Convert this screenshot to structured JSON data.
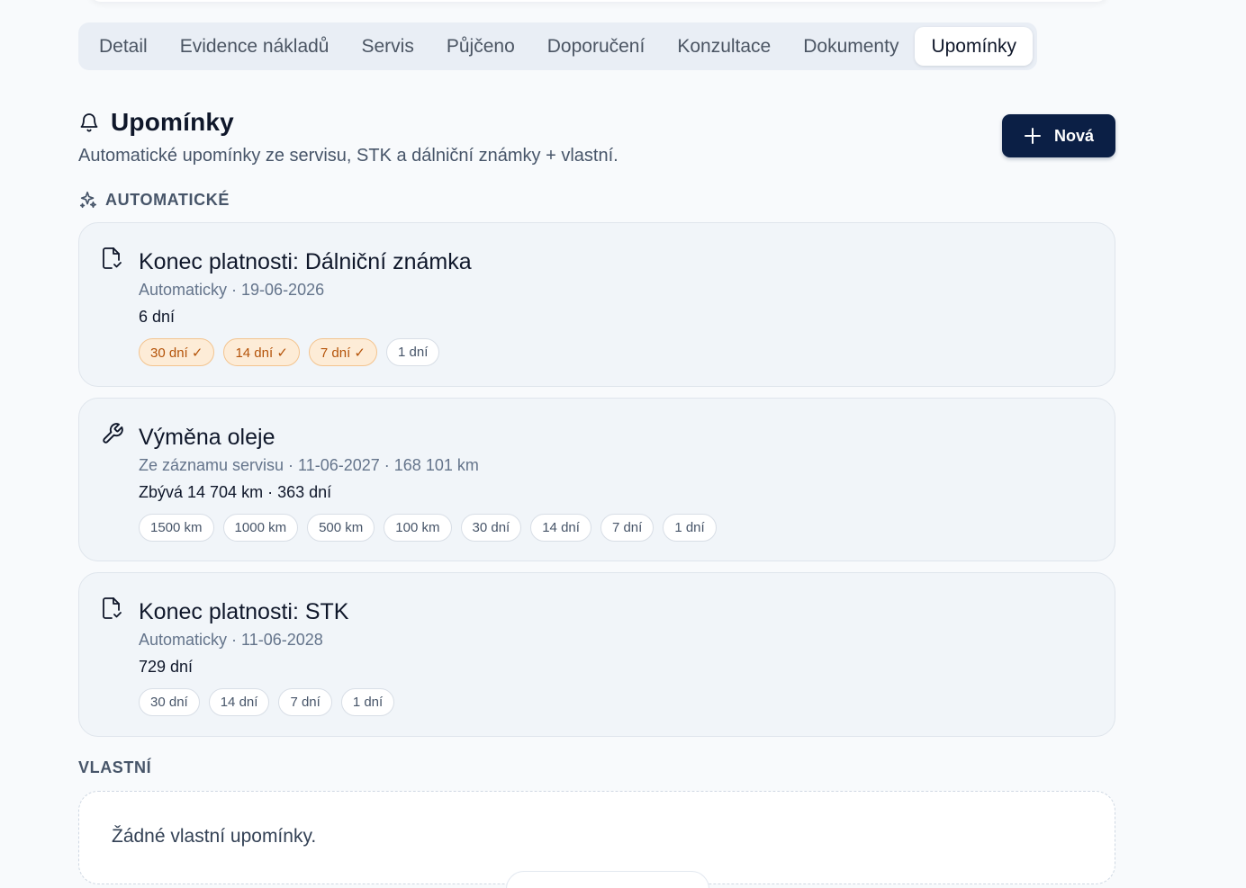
{
  "tabs": [
    {
      "label": "Detail"
    },
    {
      "label": "Evidence nákladů"
    },
    {
      "label": "Servis"
    },
    {
      "label": "Půjčeno"
    },
    {
      "label": "Doporučení"
    },
    {
      "label": "Konzultace"
    },
    {
      "label": "Dokumenty"
    },
    {
      "label": "Upomínky",
      "active": true
    }
  ],
  "header": {
    "title": "Upomínky",
    "subtitle": "Automatické upomínky ze servisu, STK a dálniční známky + vlastní.",
    "new_button_label": "Nová",
    "title_icon": "bell-icon",
    "new_icon": "plus-icon"
  },
  "automatic": {
    "heading": "AUTOMATICKÉ",
    "heading_icon": "sparkles-icon",
    "items": [
      {
        "icon": "document-check-icon",
        "title": "Konec platnosti: Dálniční známka",
        "meta": "Automaticky · 19-06-2026",
        "remaining": "6 dní",
        "chips": [
          {
            "label": "30 dní ✓",
            "done": true
          },
          {
            "label": "14 dní ✓",
            "done": true
          },
          {
            "label": "7 dní ✓",
            "done": true
          },
          {
            "label": "1 dní",
            "done": false
          }
        ]
      },
      {
        "icon": "wrench-icon",
        "title": "Výměna oleje",
        "meta": "Ze záznamu servisu · 11-06-2027 · 168 101 km",
        "remaining": "Zbývá 14 704 km · 363 dní",
        "chips": [
          {
            "label": "1500 km",
            "done": false
          },
          {
            "label": "1000 km",
            "done": false
          },
          {
            "label": "500 km",
            "done": false
          },
          {
            "label": "100 km",
            "done": false
          },
          {
            "label": "30 dní",
            "done": false
          },
          {
            "label": "14 dní",
            "done": false
          },
          {
            "label": "7 dní",
            "done": false
          },
          {
            "label": "1 dní",
            "done": false
          }
        ]
      },
      {
        "icon": "document-check-icon",
        "title": "Konec platnosti: STK",
        "meta": "Automaticky · 11-06-2028",
        "remaining": "729 dní",
        "chips": [
          {
            "label": "30 dní",
            "done": false
          },
          {
            "label": "14 dní",
            "done": false
          },
          {
            "label": "7 dní",
            "done": false
          },
          {
            "label": "1 dní",
            "done": false
          }
        ]
      }
    ]
  },
  "custom": {
    "heading": "VLASTNÍ",
    "empty_text": "Žádné vlastní upomínky."
  },
  "colors": {
    "accent": "#0b1f45",
    "chip_done_bg": "#fdecd7",
    "chip_done_text": "#b45309",
    "card_bg": "#f1f5f9",
    "page_bg": "#f8fafc"
  }
}
